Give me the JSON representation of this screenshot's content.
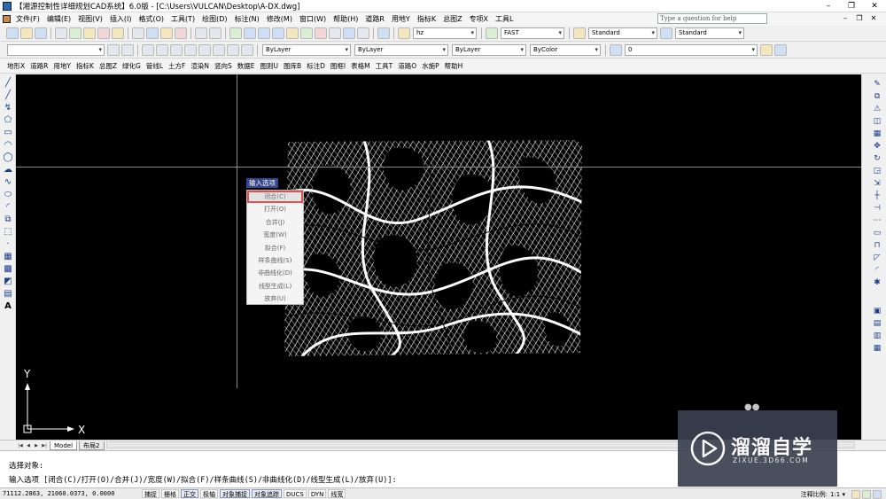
{
  "window": {
    "title": "【湘源控制性详细规划CAD系统】6.0版 - [C:\\Users\\VULCAN\\Desktop\\A-DX.dwg]",
    "controls": {
      "minimize": "–",
      "restore": "❐",
      "close": "✕"
    }
  },
  "menubar": {
    "items": [
      "文件(F)",
      "编辑(E)",
      "视图(V)",
      "插入(I)",
      "格式(O)",
      "工具(T)",
      "绘图(D)",
      "标注(N)",
      "修改(M)",
      "窗口(W)",
      "帮助(H)",
      "道路R",
      "用地Y",
      "指标K",
      "总图Z",
      "专项X",
      "工具L"
    ],
    "help_placeholder": "Type a question for help",
    "mdi_controls": {
      "minimize": "–",
      "restore": "❐",
      "close": "✕"
    }
  },
  "toolbar1": {
    "combos": {
      "layer_filter": "hz",
      "linetype_scale": "FAST",
      "text_style": "Standard",
      "dim_style": "Standard"
    }
  },
  "toolbar2": {
    "combos": {
      "color": "ByLayer",
      "linetype": "ByLayer",
      "lineweight": "ByLayer",
      "plotstyle": "ByColor",
      "layer": "0"
    }
  },
  "toolbar3": {
    "items": [
      "地形X",
      "道路R",
      "用地Y",
      "指标K",
      "总图Z",
      "绿化G",
      "管线L",
      "土方F",
      "渲染N",
      "竖向S",
      "数据E",
      "图则U",
      "图库B",
      "标注D",
      "图框I",
      "表格M",
      "工具T",
      "道路O",
      "水施P",
      "帮助H"
    ]
  },
  "popup": {
    "title": "输入选项",
    "options": [
      "闭合(C)",
      "打开(O)",
      "合并(J)",
      "宽度(W)",
      "拟合(F)",
      "样条曲线(S)",
      "非曲线化(D)",
      "线型生成(L)",
      "放弃(U)"
    ],
    "selected_index": 0
  },
  "ucs": {
    "x_label": "X",
    "y_label": "Y"
  },
  "tabs": {
    "nav": [
      "|◀",
      "◀",
      "▶",
      "▶|"
    ],
    "items": [
      "Model",
      "布局2"
    ],
    "active_index": 0
  },
  "command": {
    "line1": "选择对象:",
    "line2": "输入选项 [闭合(C)/打开(O)/合并(J)/宽度(W)/拟合(F)/样条曲线(S)/非曲线化(D)/线型生成(L)/放弃(U)]:"
  },
  "status": {
    "coords": "71112.2863, 21060.0373, 0.0000",
    "toggles": [
      "捕捉",
      "栅格",
      "正交",
      "极轴",
      "对象捕捉",
      "对象追踪",
      "DUCS",
      "DYN",
      "线宽"
    ],
    "annotation_scale_label": "注释比例:",
    "annotation_scale_value": "1:1 ▾"
  },
  "watermark": {
    "brand": "溜溜自学",
    "url": "ZIXUE.3D66.COM"
  },
  "colors": {
    "viewport_bg": "#000000",
    "popup_title_bg": "#34478c",
    "highlight_border": "#d9534f",
    "watermark_bg": "#3b4151"
  }
}
